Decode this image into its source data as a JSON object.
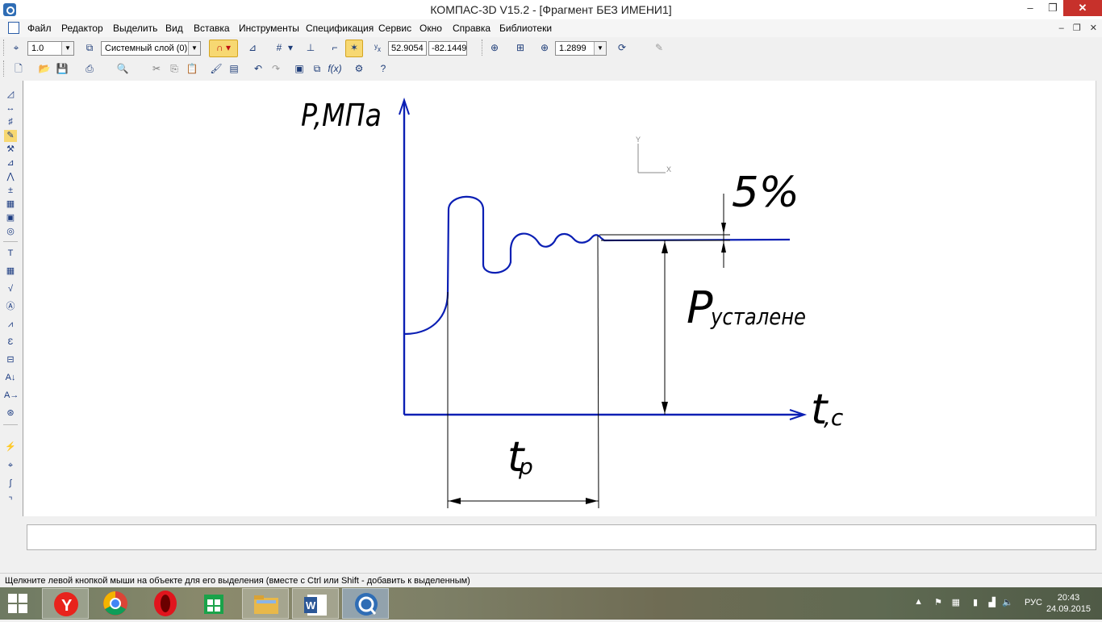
{
  "window": {
    "title": "КОМПАС-3D V15.2  - [Фрагмент БЕЗ ИМЕНИ1]",
    "min": "–",
    "max": "❐",
    "close": "✕"
  },
  "menu": {
    "items": [
      "Файл",
      "Редактор",
      "Выделить",
      "Вид",
      "Вставка",
      "Инструменты",
      "Спецификация",
      "Сервис",
      "Окно",
      "Справка",
      "Библиотеки"
    ],
    "mdi_min": "–",
    "mdi_restore": "❐",
    "mdi_close": "✕"
  },
  "toolbar_current": {
    "step": "1.0",
    "layer": "Системный слой (0)",
    "coord_x": "52.9054",
    "coord_y": "-82.1449",
    "zoom": "1.2899"
  },
  "left_tools": [
    "geometry-icon",
    "dimensions-icon",
    "symbols-icon",
    "edit-icon",
    "parametrization-icon",
    "measure-icon",
    "select-icon",
    "spec-icon",
    "reports-icon",
    "insert-icon",
    "fragment-icon"
  ],
  "drawing": {
    "y_axis_label": "P,МПа",
    "x_axis_label_main": "t",
    "x_axis_label_sub": ",c",
    "tolerance_label": "5%",
    "steady_label_main": "P",
    "steady_label_sub": "усталене",
    "time_label_main": "t",
    "time_label_sub": "p",
    "cs_x": "X",
    "cs_y": "Y",
    "colors": {
      "curve": "#0b1fb4",
      "dim": "#000000"
    }
  },
  "status": {
    "hint": "Щелкните левой кнопкой мыши на объекте для его выделения (вместе с Ctrl или Shift - добавить к выделенным)"
  },
  "taskbar": {
    "apps": [
      "yandex-browser",
      "chrome",
      "opera",
      "store",
      "file-explorer",
      "word",
      "kompas"
    ],
    "lang": "РУС",
    "time": "20:43",
    "date": "24.09.2015"
  }
}
